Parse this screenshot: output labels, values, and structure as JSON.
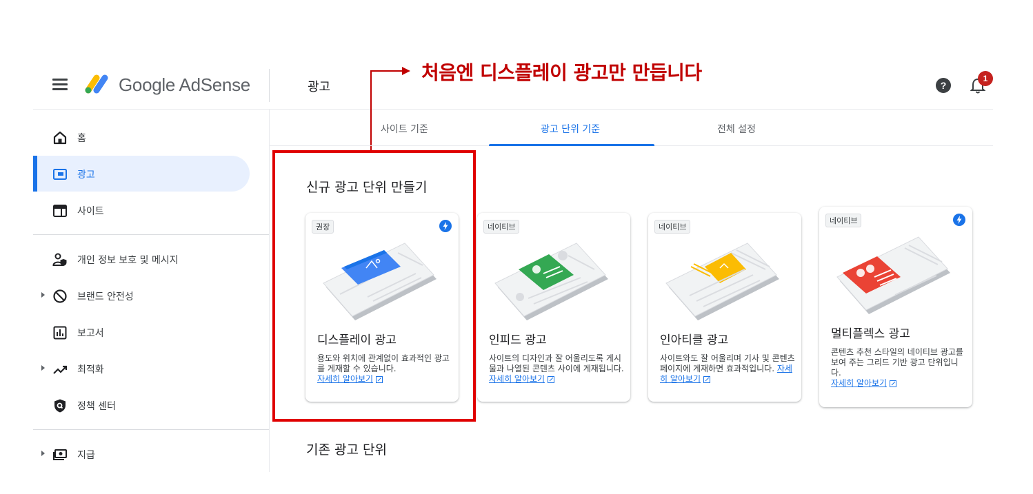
{
  "header": {
    "brand": "Google AdSense",
    "page_title": "광고",
    "notification_count": "1"
  },
  "annotation": {
    "text": "처음엔 디스플레이 광고만 만듭니다"
  },
  "sidebar": {
    "items": [
      {
        "label": "홈",
        "icon": "home-icon"
      },
      {
        "label": "광고",
        "icon": "ads-icon"
      },
      {
        "label": "사이트",
        "icon": "sites-icon"
      },
      {
        "label": "개인 정보 보호 및 메시지",
        "icon": "privacy-icon"
      },
      {
        "label": "브랜드 안전성",
        "icon": "block-icon"
      },
      {
        "label": "보고서",
        "icon": "reports-icon"
      },
      {
        "label": "최적화",
        "icon": "trending-icon"
      },
      {
        "label": "정책 센터",
        "icon": "policy-shield-icon"
      },
      {
        "label": "지급",
        "icon": "payments-icon"
      }
    ]
  },
  "tabs": [
    {
      "label": "사이트 기준"
    },
    {
      "label": "광고 단위 기준"
    },
    {
      "label": "전체 설정"
    }
  ],
  "sections": {
    "new_units": "신규 광고 단위 만들기",
    "existing_units": "기존 광고 단위"
  },
  "cards": [
    {
      "badge": "권장",
      "title": "디스플레이 광고",
      "desc": "용도와 위치에 관계없이 효과적인 광고를 게재할 수 있습니다.",
      "link": "자세히 알아보기",
      "accent": "#4285f4"
    },
    {
      "badge": "네이티브",
      "title": "인피드 광고",
      "desc": "사이트의 디자인과 잘 어울리도록 게시물과 나열된 콘텐츠 사이에 게재됩니다.",
      "link": "자세히 알아보기",
      "accent": "#34a853"
    },
    {
      "badge": "네이티브",
      "title": "인아티클 광고",
      "desc": "사이트와도 잘 어울리며 기사 및 콘텐츠 페이지에 게재하면 효과적입니다.",
      "link": "자세히 알아보기",
      "accent": "#fbbc04"
    },
    {
      "badge": "네이티브",
      "title": "멀티플렉스 광고",
      "desc": "콘텐츠 추천 스타일의 네이티브 광고를 보여 주는 그리드 기반 광고 단위입니다.",
      "link": "자세히 알아보기",
      "accent": "#ea4335"
    }
  ],
  "colors": {
    "primary": "#1a73e8",
    "annotation": "#c00000",
    "badge": "#c5221f"
  }
}
